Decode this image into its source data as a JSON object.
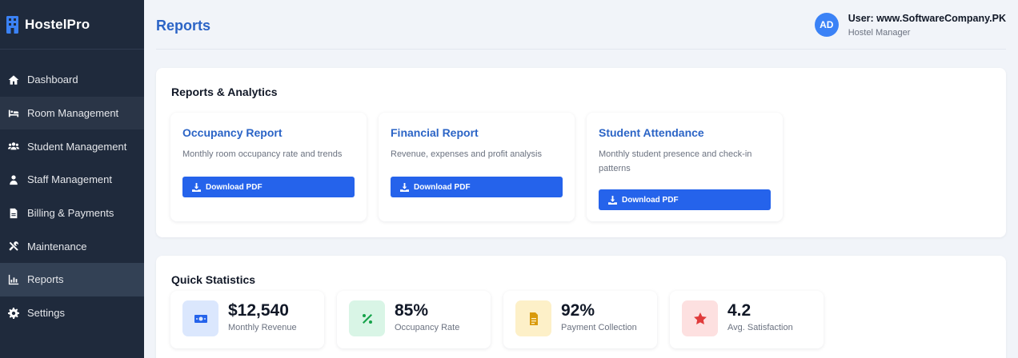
{
  "app": {
    "name": "HostelPro"
  },
  "sidebar": {
    "items": [
      {
        "label": "Dashboard",
        "icon": "home-icon"
      },
      {
        "label": "Room Management",
        "icon": "bed-icon"
      },
      {
        "label": "Student Management",
        "icon": "users-icon"
      },
      {
        "label": "Staff Management",
        "icon": "user-tie-icon"
      },
      {
        "label": "Billing & Payments",
        "icon": "invoice-icon"
      },
      {
        "label": "Maintenance",
        "icon": "tools-icon"
      },
      {
        "label": "Reports",
        "icon": "chart-icon",
        "active": true
      },
      {
        "label": "Settings",
        "icon": "gear-icon"
      }
    ]
  },
  "header": {
    "title": "Reports",
    "user": {
      "initials": "AD",
      "name": "User: www.SoftwareCompany.PK",
      "role": "Hostel Manager"
    }
  },
  "reports": {
    "title": "Reports & Analytics",
    "cards": [
      {
        "title": "Occupancy Report",
        "description": "Monthly room occupancy rate and trends",
        "button": "Download PDF"
      },
      {
        "title": "Financial Report",
        "description": "Revenue, expenses and profit analysis",
        "button": "Download PDF"
      },
      {
        "title": "Student Attendance",
        "description": "Monthly student presence and check-in patterns",
        "button": "Download PDF"
      }
    ]
  },
  "stats": {
    "title": "Quick Statistics",
    "items": [
      {
        "value": "$12,540",
        "label": "Monthly Revenue",
        "icon": "money-icon",
        "bg": "#dbe7fd",
        "color": "#2563eb"
      },
      {
        "value": "85%",
        "label": "Occupancy Rate",
        "icon": "percent-icon",
        "bg": "#d9f5e6",
        "color": "#16a34a"
      },
      {
        "value": "92%",
        "label": "Payment Collection",
        "icon": "document-icon",
        "bg": "#fdf0c8",
        "color": "#d99a0b"
      },
      {
        "value": "4.2",
        "label": "Avg. Satisfaction",
        "icon": "star-icon",
        "bg": "#fde0e0",
        "color": "#e03b3b"
      }
    ]
  },
  "colors": {
    "sidebar_bg": "#1f2a3c",
    "accent": "#2563eb",
    "title_blue": "#2b64c6"
  }
}
